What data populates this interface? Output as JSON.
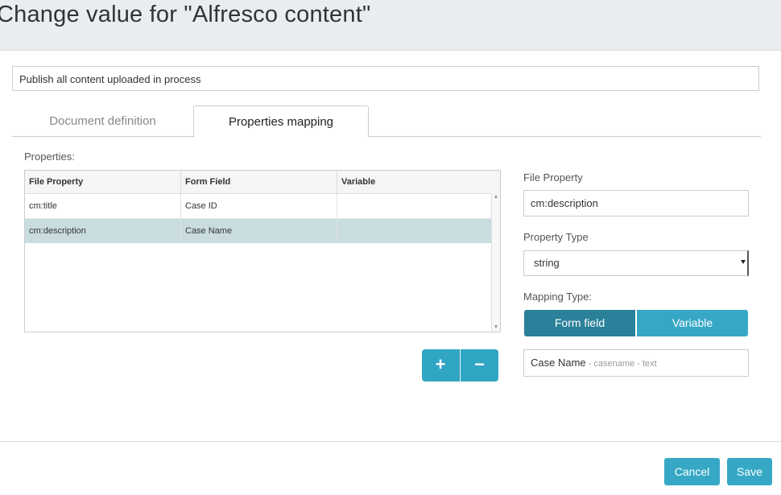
{
  "dialog": {
    "title": "Change value for \"Alfresco content\"",
    "description_value": "Publish all content uploaded in process"
  },
  "tabs": [
    {
      "label": "Document definition",
      "active": false
    },
    {
      "label": "Properties mapping",
      "active": true
    }
  ],
  "properties": {
    "label": "Properties:",
    "columns": [
      "File Property",
      "Form Field",
      "Variable"
    ],
    "rows": [
      {
        "file_property": "cm:title",
        "form_field": "Case ID",
        "variable": "",
        "selected": false
      },
      {
        "file_property": "cm:description",
        "form_field": "Case Name",
        "variable": "",
        "selected": true
      }
    ],
    "add_label": "+",
    "remove_label": "−"
  },
  "details": {
    "file_property_label": "File Property",
    "file_property_value": "cm:description",
    "property_type_label": "Property Type",
    "property_type_value": "string",
    "mapping_type_label": "Mapping Type:",
    "mapping_options": [
      "Form field",
      "Variable"
    ],
    "mapping_selected": "Form field",
    "value_main": "Case Name",
    "value_sub": " - casename - text"
  },
  "footer": {
    "cancel_label": "Cancel",
    "save_label": "Save"
  },
  "colors": {
    "accent": "#36a8c6",
    "accent_dark": "#2a8199",
    "selected_row": "#c9dde0",
    "header_bg": "#e9edf0"
  }
}
